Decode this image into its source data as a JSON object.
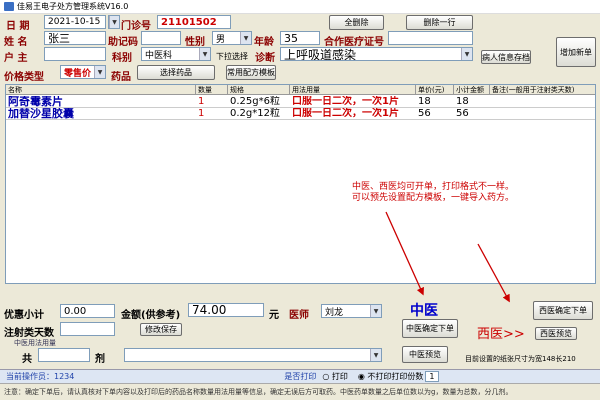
{
  "window": {
    "title": "佳易王电子处方管理系统V16.0"
  },
  "form": {
    "date_label": "日  期",
    "date_value": "2021-10-15",
    "clinic_no_label": "门诊号",
    "clinic_no_value": "21101502",
    "delete_all_label": "全删除",
    "delete_row_label": "删除一行",
    "name_label": "姓 名",
    "name_value": "张三",
    "memo_code_label": "助记码",
    "memo_code_value": "",
    "gender_label": "性别",
    "gender_value": "男",
    "age_label": "年龄",
    "age_value": "35",
    "insurance_label": "合作医疗证号",
    "insurance_value": "",
    "owner_label": "户 主",
    "owner_value": "",
    "dept_label": "科别",
    "dept_value": "中医科",
    "dropdown_hint": "下拉选择",
    "diagnosis_label": "诊断",
    "diagnosis_value": "上呼吸道感染",
    "patient_save_label": "病人信息存档",
    "add_new_label": "增加新单",
    "price_type_label": "价格类型",
    "price_type_value": "零售价",
    "drug_label": "药品",
    "select_drug_label": "选择药品",
    "template_label": "常用配方模板"
  },
  "table": {
    "columns": [
      "名称",
      "数量",
      "规格",
      "用法用量",
      "单价(元)",
      "小计金额",
      "备注(一般用于注射类天数)"
    ],
    "rows": [
      {
        "name": "阿奇霉素片",
        "qty": "1",
        "spec": "0.25g*6粒",
        "usage": "口服一日二次，一次1片",
        "price": "18",
        "subtotal": "18",
        "remark": ""
      },
      {
        "name": "加替沙星胶囊",
        "qty": "1",
        "spec": "0.2g*12粒",
        "usage": "口服一日二次，一次1片",
        "price": "56",
        "subtotal": "56",
        "remark": ""
      }
    ]
  },
  "annotation": {
    "line1": "中医、西医均可开单，打印格式不一样。",
    "line2": "可以预先设置配方模板，一键导入药方。"
  },
  "bottom": {
    "discount_label": "优惠小计",
    "discount_value": "0.00",
    "amount_label": "金额(供参考)",
    "amount_value": "74.00",
    "yuan_label": "元",
    "doctor_label": "医师",
    "doctor_value": "刘龙",
    "tcm_big_label": "中医",
    "western_big_label": "西医>>",
    "western_confirm_label": "西医确定下单",
    "injection_days_label": "注射类天数",
    "injection_days_value": "",
    "modify_save_label": "修改保存",
    "tcm_confirm_label": "中医确定下单",
    "western_preview_label": "西医预览",
    "tcm_usage_label": "中医用法用量",
    "total_label": "共",
    "total_value": "",
    "dose_unit_label": "剂",
    "tcm_usage_value": "",
    "tcm_preview_label": "中医预览",
    "paper_size_text": "目前设置的纸张尺寸为宽148长210"
  },
  "status": {
    "operator_label": "当前操作员：",
    "operator_value": "1234",
    "print_question": "是否打印",
    "print_option": "打印",
    "no_print_option": "不打印",
    "print_copies_label": "打印份数",
    "print_copies_value": "1"
  },
  "hint": {
    "text": "注意：确定下单后，请认真核对下单内容以及打印后的药品名称数量用法用量等信息，确定无误后方可取药。中医药单数量之后单位数以为g，数量为总数，分几剂。"
  }
}
